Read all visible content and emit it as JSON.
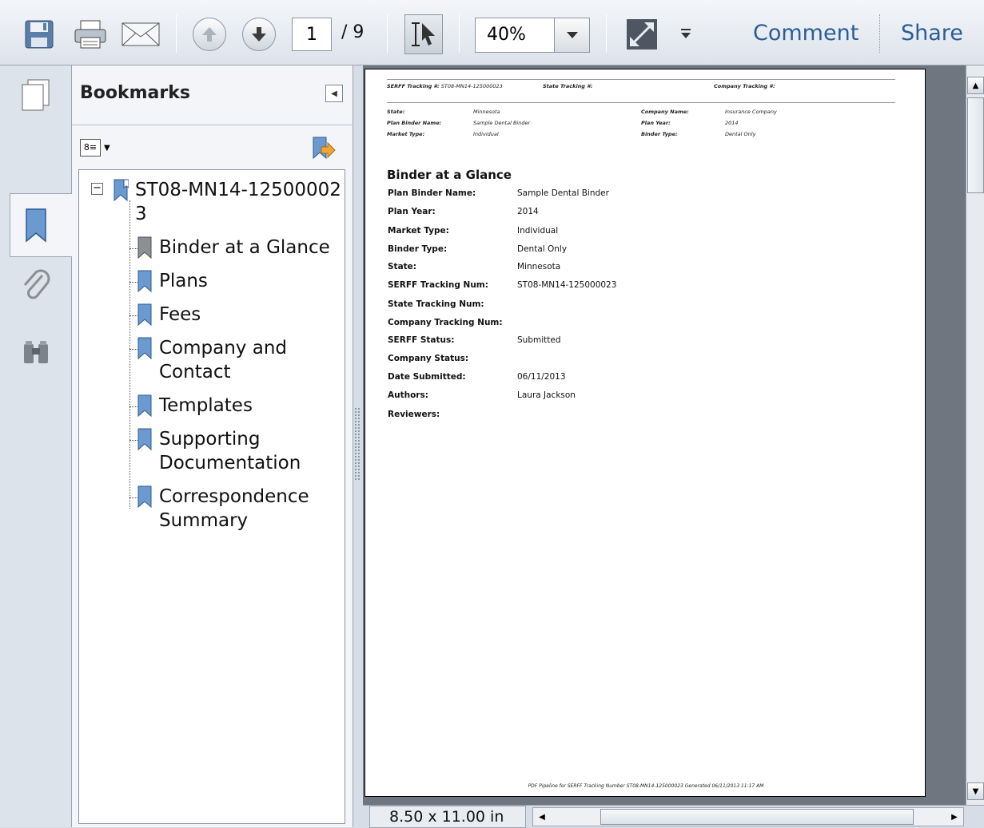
{
  "toolbar": {
    "page_current": "1",
    "page_total": "/ 9",
    "zoom": "40%",
    "comment": "Comment",
    "share": "Share",
    "icons": [
      "save-icon",
      "print-icon",
      "email-icon",
      "previous-page-icon",
      "next-page-icon",
      "select-tool-icon",
      "fullscreen-icon",
      "toolbar-menu-icon"
    ]
  },
  "bookmarks": {
    "title": "Bookmarks",
    "root": "ST08-MN14-125000023",
    "root_line1": "ST08-MN14-12500002",
    "root_line2": "3",
    "items": [
      {
        "lines": [
          "Binder at a Glance"
        ],
        "active": true
      },
      {
        "lines": [
          "Plans"
        ]
      },
      {
        "lines": [
          "Fees"
        ]
      },
      {
        "lines": [
          "Company and",
          "Contact"
        ]
      },
      {
        "lines": [
          "Templates"
        ]
      },
      {
        "lines": [
          "Supporting",
          "Documentation"
        ]
      },
      {
        "lines": [
          "Correspondence",
          "Summary"
        ]
      }
    ]
  },
  "document": {
    "header": {
      "serff_label": "SERFF Tracking #:",
      "serff_value": "ST08-MN14-125000023",
      "state_tracking_label": "State Tracking #:",
      "company_tracking_label": "Company Tracking #:",
      "state_label": "State:",
      "state_value": "Minnesota",
      "plan_binder_label": "Plan Binder Name:",
      "plan_binder_value": "Sample Dental Binder",
      "market_type_label": "Market Type:",
      "market_type_value": "Individual",
      "company_name_label": "Company Name:",
      "company_name_value": "Insurance Company",
      "plan_year_label": "Plan Year:",
      "plan_year_value": "2014",
      "binder_type_label": "Binder Type:",
      "binder_type_value": "Dental Only"
    },
    "title": "Binder at a Glance",
    "rows": [
      {
        "k": "Plan Binder Name:",
        "v": "Sample Dental Binder"
      },
      {
        "k": "Plan Year:",
        "v": "2014"
      },
      {
        "k": "Market Type:",
        "v": "Individual"
      },
      {
        "k": "Binder Type:",
        "v": "Dental Only"
      },
      {
        "k": "State:",
        "v": "Minnesota"
      },
      {
        "k": "SERFF Tracking Num:",
        "v": "ST08-MN14-125000023"
      },
      {
        "k": "State Tracking Num:",
        "v": ""
      },
      {
        "k": "Company Tracking Num:",
        "v": ""
      },
      {
        "k": "SERFF Status:",
        "v": "Submitted"
      },
      {
        "k": "Company Status:",
        "v": ""
      },
      {
        "k": "Date Submitted:",
        "v": "06/11/2013"
      },
      {
        "k": "Authors:",
        "v": "Laura Jackson"
      },
      {
        "k": "Reviewers:",
        "v": ""
      }
    ],
    "footer": "PDF Pipeline for SERFF Tracking Number ST08-MN14-125000023 Generated 06/11/2013 11:17 AM"
  },
  "status": {
    "page_size": "8.50 x 11.00 in"
  }
}
